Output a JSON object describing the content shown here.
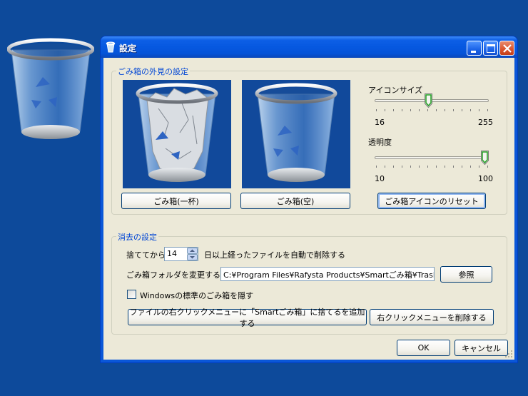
{
  "window": {
    "title": "設定"
  },
  "appearance": {
    "group_label": "ごみ箱の外見の設定",
    "full_button": "ごみ箱(一杯)",
    "empty_button": "ごみ箱(空)",
    "icon_size": {
      "label": "アイコンサイズ",
      "min": "16",
      "max": "255",
      "value": 128
    },
    "opacity": {
      "label": "透明度",
      "min": "10",
      "max": "100",
      "value": 100
    },
    "reset_button": "ごみ箱アイコンのリセット"
  },
  "deletion": {
    "group_label": "消去の設定",
    "discard_prefix": "捨ててから",
    "days_value": "14",
    "discard_suffix": "日以上経ったファイルを自動で削除する",
    "folder_label": "ごみ箱フォルダを変更する",
    "folder_path": "C:¥Program Files¥Rafysta Products¥Smartごみ箱¥Trash",
    "browse_button": "参照",
    "hide_std_label": "Windowsの標準のごみ箱を隠す",
    "hide_std_checked": false,
    "add_menu_button": "ファイルの右クリックメニューに「Smartごみ箱」に捨てるを追加する",
    "remove_menu_button": "右クリックメニューを削除する"
  },
  "footer": {
    "ok": "OK",
    "cancel": "キャンセル"
  },
  "colors": {
    "desktop": "#0d4a9b",
    "titlebar": "#0658e0",
    "dialog": "#ece9d8",
    "group_label": "#0046d5"
  }
}
